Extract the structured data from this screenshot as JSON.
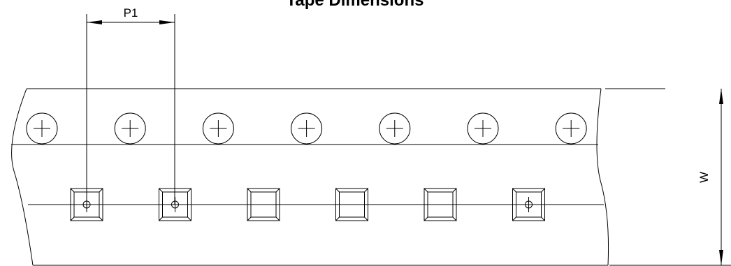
{
  "title": "Tape Dimensions",
  "labels": {
    "pitch": "P1",
    "width": "W"
  },
  "sprocket_holes": 7,
  "pockets": [
    {
      "has_component": true
    },
    {
      "has_component": true
    },
    {
      "has_component": false
    },
    {
      "has_component": false
    },
    {
      "has_component": false
    },
    {
      "has_component": true
    }
  ]
}
